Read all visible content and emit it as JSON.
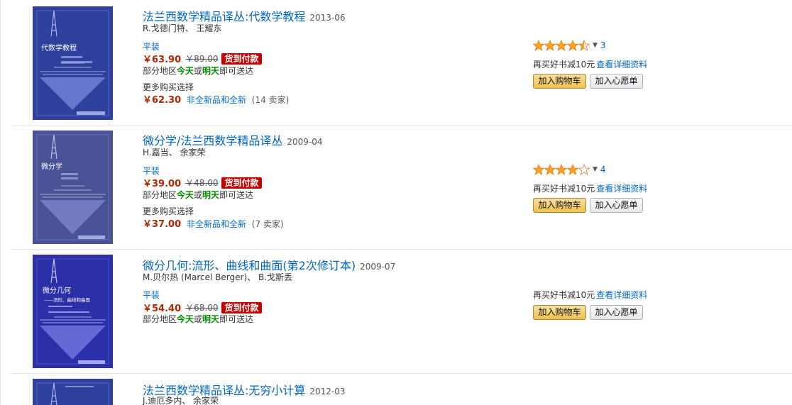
{
  "colors": {
    "link": "#0066c0",
    "price": "#b12704",
    "badge": "#c40000",
    "green": "#008a00",
    "star": "#ffa41c"
  },
  "products": [
    {
      "title": "法兰西数学精品译丛:代数学教程",
      "date": "2013-06",
      "author": "R.戈德门特、 王耀东",
      "cover_title": "代数学教程",
      "binding": "平装",
      "price": "￥63.90",
      "list_price": "￥89.00",
      "cod": "货到付款",
      "delivery": {
        "prefix": "部分地区",
        "today": "今天",
        "or": "或",
        "tomorrow": "明天",
        "suffix": "即可送达"
      },
      "more_label": "更多购买选择",
      "more_price": "￥62.30",
      "more_link": "非全新品和全新",
      "more_count": "(14 卖家)",
      "rating_stars": 4.5,
      "rating_count": "3",
      "promo_text": "再买好书减10元",
      "promo_link": "查看详细资料",
      "cart_btn": "加入购物车",
      "wish_btn": "加入心愿单"
    },
    {
      "title": "微分学/法兰西数学精品译丛",
      "date": "2009-04",
      "author": "H.嘉当、 余家荣",
      "cover_title": "微分学",
      "binding": "平装",
      "price": "￥39.00",
      "list_price": "￥48.00",
      "cod": "货到付款",
      "delivery": {
        "prefix": "部分地区",
        "today": "今天",
        "or": "或",
        "tomorrow": "明天",
        "suffix": "即可送达"
      },
      "more_label": "更多购买选择",
      "more_price": "￥37.00",
      "more_link": "非全新品和全新",
      "more_count": "(7 卖家)",
      "rating_stars": 4,
      "rating_count": "4",
      "promo_text": "再买好书减10元",
      "promo_link": "查看详细资料",
      "cart_btn": "加入购物车",
      "wish_btn": "加入心愿单"
    },
    {
      "title": "微分几何:流形、曲线和曲面(第2次修订本)",
      "date": "2009-07",
      "author": "M.贝尔热 (Marcel Berger)、 B.戈斯丢",
      "cover_title": "微分几何",
      "cover_subtitle": "——流形、曲线和曲面",
      "binding": "平装",
      "price": "￥54.40",
      "list_price": "￥68.00",
      "cod": "货到付款",
      "delivery": {
        "prefix": "部分地区",
        "today": "今天",
        "or": "或",
        "tomorrow": "明天",
        "suffix": "即可送达"
      },
      "promo_text": "再买好书减10元",
      "promo_link": "查看详细资料",
      "cart_btn": "加入购物车",
      "wish_btn": "加入心愿单"
    },
    {
      "title": "法兰西数学精品译丛:无穷小计算",
      "date": "2012-03",
      "author": "J.迪厄多内、 余家荣"
    }
  ]
}
